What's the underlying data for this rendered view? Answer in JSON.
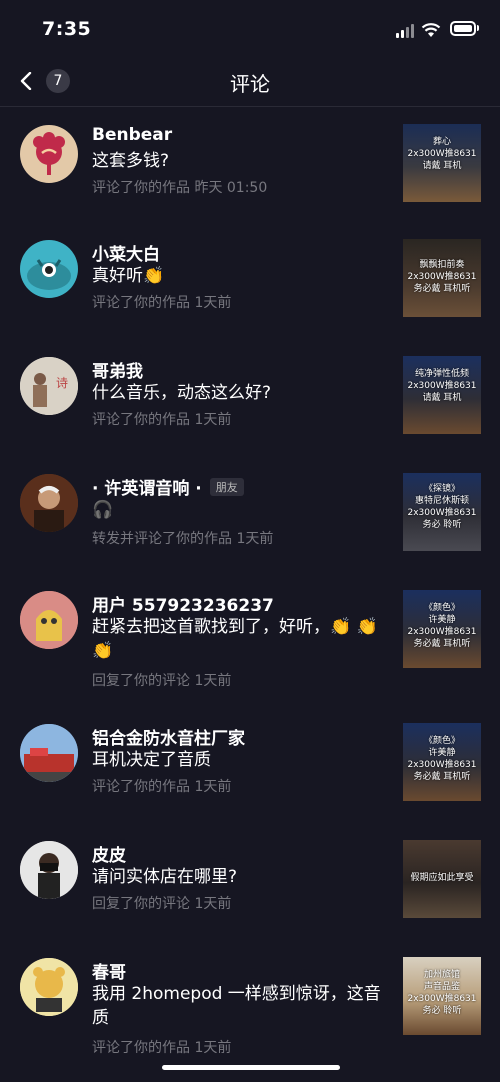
{
  "status": {
    "time": "7:35"
  },
  "nav": {
    "back_count": "7",
    "title": "评论"
  },
  "comments": [
    {
      "name": "Benbear",
      "text": "这套多钱?",
      "meta": "评论了你的作品  昨天 01:50",
      "thumb": [
        "葬心",
        "2x300W推8631",
        "请戴   耳机"
      ]
    },
    {
      "name": "小菜大白",
      "text": "真好听👏",
      "meta": "评论了你的作品  1天前",
      "thumb": [
        "飘飘扣前奏",
        "2x300W推8631",
        "务必戴  耳机听"
      ]
    },
    {
      "name": "哥弟我",
      "text": "什么音乐，动态这么好?",
      "meta": "评论了你的作品  1天前",
      "thumb": [
        "纯净弹性低频",
        "2x300W推8631",
        "请戴   耳机"
      ]
    },
    {
      "name": "· 许英谓音响 ·",
      "tag": "朋友",
      "text": "🎧",
      "meta": "转发并评论了你的作品  1天前",
      "thumb": [
        "《探镜》",
        "惠特尼休斯顿",
        "2x300W推8631",
        "务必    聆听"
      ]
    },
    {
      "name": "用户 557923236237",
      "text": "赶紧去把这首歌找到了，好听，👏 👏👏",
      "meta": "回复了你的评论  1天前",
      "thumb": [
        "《颜色》",
        "许美静",
        "2x300W推8631",
        "务必戴  耳机听"
      ]
    },
    {
      "name": "铝合金防水音柱厂家",
      "text": "耳机决定了音质",
      "meta": "评论了你的作品  1天前",
      "thumb": [
        "《颜色》",
        "许美静",
        "2x300W推8631",
        "务必戴  耳机听"
      ]
    },
    {
      "name": "皮皮",
      "text": "请问实体店在哪里?",
      "meta": "回复了你的评论  1天前",
      "thumb": [
        "假期应如此享受"
      ]
    },
    {
      "name": "春哥",
      "text": "我用 2homepod 一样感到惊讶，这音质",
      "meta": "评论了你的作品  1天前",
      "thumb": [
        "加州旅馆",
        "声音品鉴",
        "2x300W推8631",
        "务必    聆听"
      ]
    }
  ],
  "colors": {
    "background": "#161622",
    "meta_text": "#77777f"
  }
}
